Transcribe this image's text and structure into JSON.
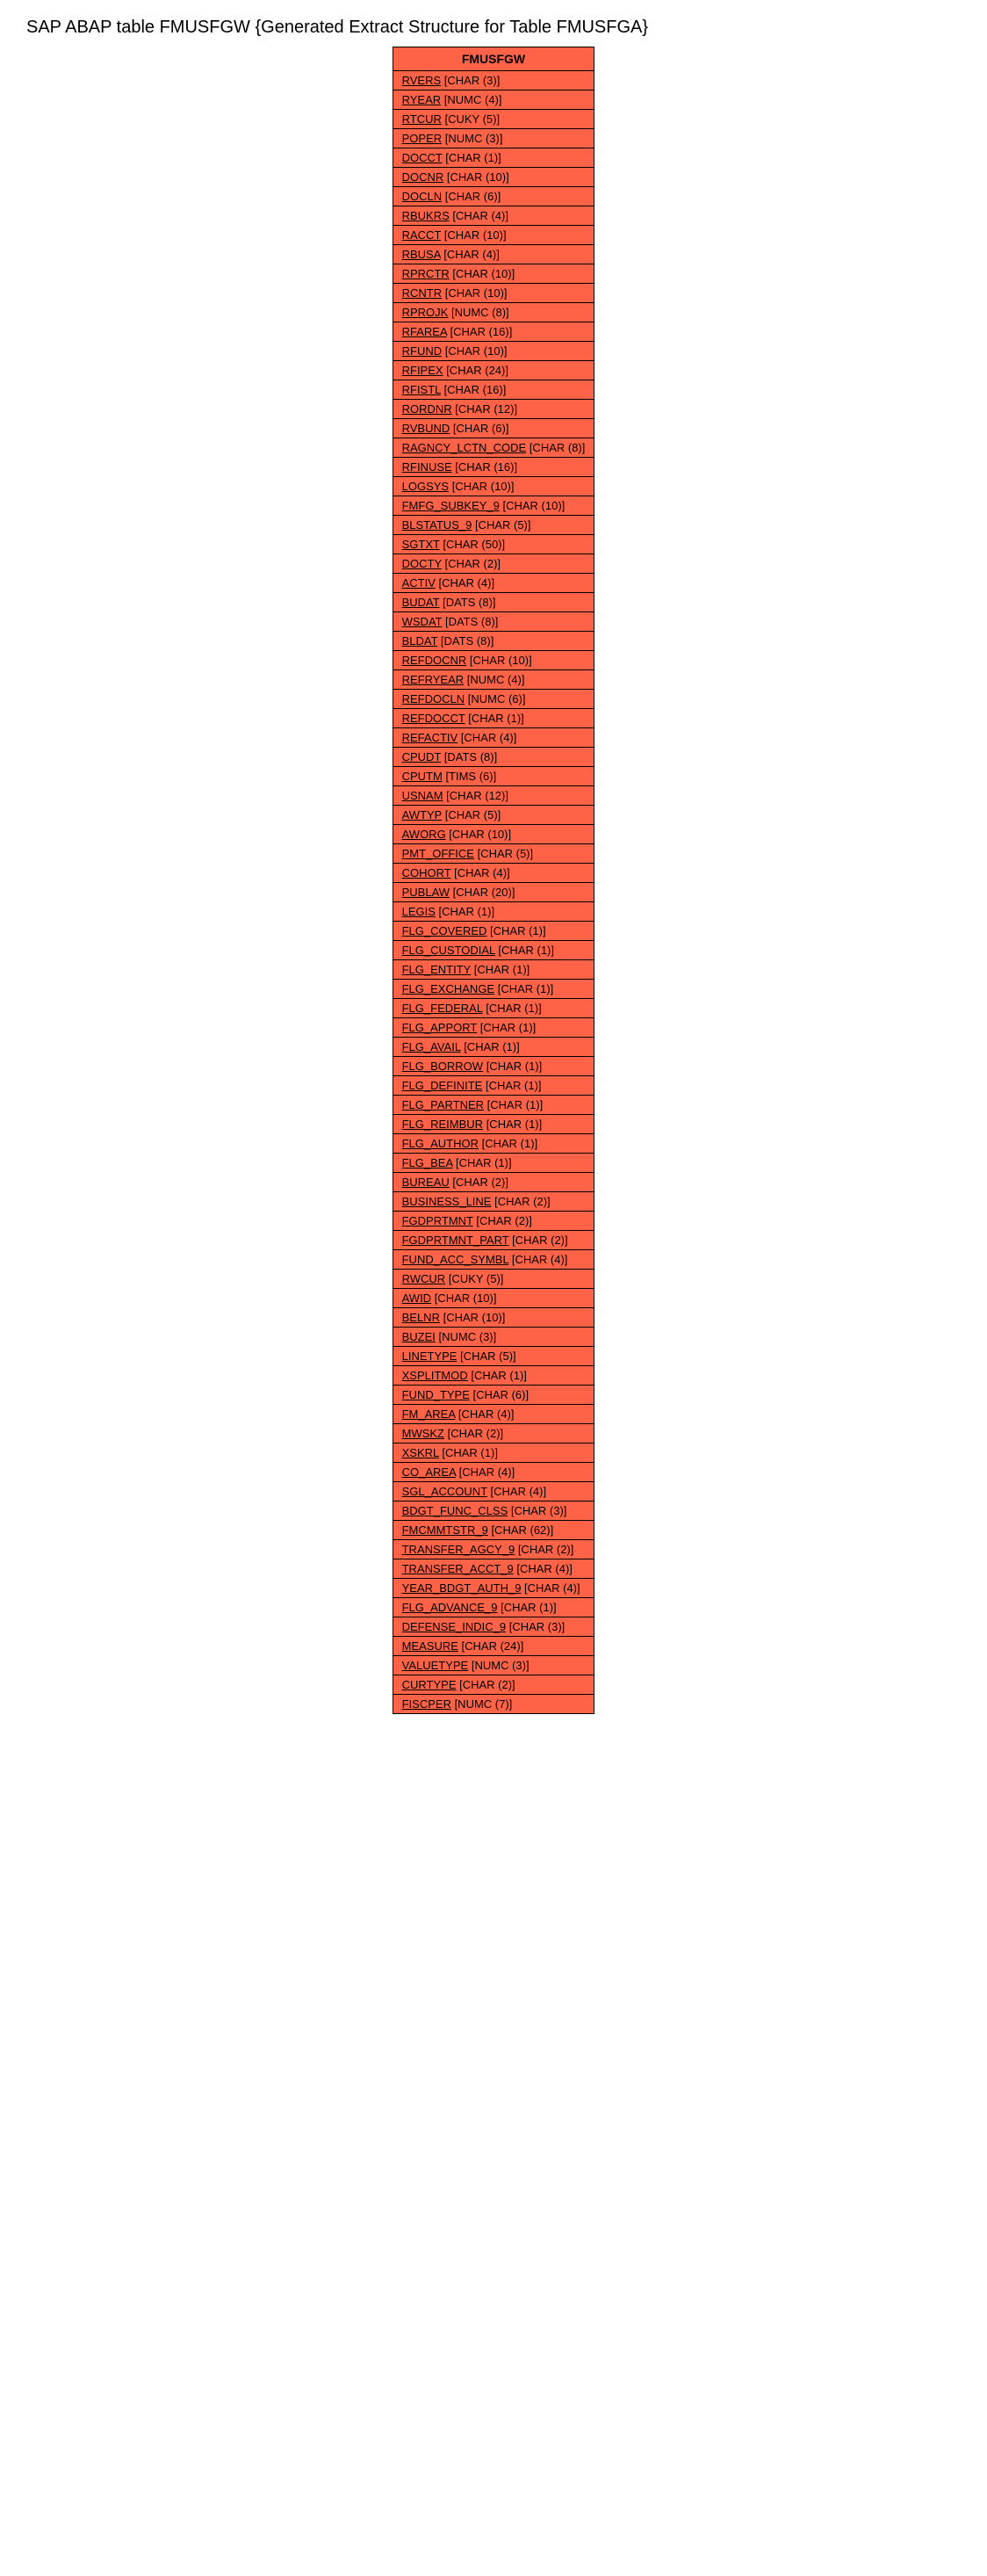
{
  "title": "SAP ABAP table FMUSFGW {Generated Extract Structure for Table FMUSFGA}",
  "table": {
    "header": "FMUSFGW",
    "fields": [
      {
        "name": "RVERS",
        "type": "[CHAR (3)]"
      },
      {
        "name": "RYEAR",
        "type": "[NUMC (4)]"
      },
      {
        "name": "RTCUR",
        "type": "[CUKY (5)]"
      },
      {
        "name": "POPER",
        "type": "[NUMC (3)]"
      },
      {
        "name": "DOCCT",
        "type": "[CHAR (1)]"
      },
      {
        "name": "DOCNR",
        "type": "[CHAR (10)]"
      },
      {
        "name": "DOCLN",
        "type": "[CHAR (6)]"
      },
      {
        "name": "RBUKRS",
        "type": "[CHAR (4)]"
      },
      {
        "name": "RACCT",
        "type": "[CHAR (10)]"
      },
      {
        "name": "RBUSA",
        "type": "[CHAR (4)]"
      },
      {
        "name": "RPRCTR",
        "type": "[CHAR (10)]"
      },
      {
        "name": "RCNTR",
        "type": "[CHAR (10)]"
      },
      {
        "name": "RPROJK",
        "type": "[NUMC (8)]"
      },
      {
        "name": "RFAREA",
        "type": "[CHAR (16)]"
      },
      {
        "name": "RFUND",
        "type": "[CHAR (10)]"
      },
      {
        "name": "RFIPEX",
        "type": "[CHAR (24)]"
      },
      {
        "name": "RFISTL",
        "type": "[CHAR (16)]"
      },
      {
        "name": "RORDNR",
        "type": "[CHAR (12)]"
      },
      {
        "name": "RVBUND",
        "type": "[CHAR (6)]"
      },
      {
        "name": "RAGNCY_LCTN_CODE",
        "type": "[CHAR (8)]"
      },
      {
        "name": "RFINUSE",
        "type": "[CHAR (16)]"
      },
      {
        "name": "LOGSYS",
        "type": "[CHAR (10)]"
      },
      {
        "name": "FMFG_SUBKEY_9",
        "type": "[CHAR (10)]"
      },
      {
        "name": "BLSTATUS_9",
        "type": "[CHAR (5)]"
      },
      {
        "name": "SGTXT",
        "type": "[CHAR (50)]"
      },
      {
        "name": "DOCTY",
        "type": "[CHAR (2)]"
      },
      {
        "name": "ACTIV",
        "type": "[CHAR (4)]"
      },
      {
        "name": "BUDAT",
        "type": "[DATS (8)]"
      },
      {
        "name": "WSDAT",
        "type": "[DATS (8)]"
      },
      {
        "name": "BLDAT",
        "type": "[DATS (8)]"
      },
      {
        "name": "REFDOCNR",
        "type": "[CHAR (10)]"
      },
      {
        "name": "REFRYEAR",
        "type": "[NUMC (4)]"
      },
      {
        "name": "REFDOCLN",
        "type": "[NUMC (6)]"
      },
      {
        "name": "REFDOCCT",
        "type": "[CHAR (1)]"
      },
      {
        "name": "REFACTIV",
        "type": "[CHAR (4)]"
      },
      {
        "name": "CPUDT",
        "type": "[DATS (8)]"
      },
      {
        "name": "CPUTM",
        "type": "[TIMS (6)]"
      },
      {
        "name": "USNAM",
        "type": "[CHAR (12)]"
      },
      {
        "name": "AWTYP",
        "type": "[CHAR (5)]"
      },
      {
        "name": "AWORG",
        "type": "[CHAR (10)]"
      },
      {
        "name": "PMT_OFFICE",
        "type": "[CHAR (5)]"
      },
      {
        "name": "COHORT",
        "type": "[CHAR (4)]"
      },
      {
        "name": "PUBLAW",
        "type": "[CHAR (20)]"
      },
      {
        "name": "LEGIS",
        "type": "[CHAR (1)]"
      },
      {
        "name": "FLG_COVERED",
        "type": "[CHAR (1)]"
      },
      {
        "name": "FLG_CUSTODIAL",
        "type": "[CHAR (1)]"
      },
      {
        "name": "FLG_ENTITY",
        "type": "[CHAR (1)]"
      },
      {
        "name": "FLG_EXCHANGE",
        "type": "[CHAR (1)]"
      },
      {
        "name": "FLG_FEDERAL",
        "type": "[CHAR (1)]"
      },
      {
        "name": "FLG_APPORT",
        "type": "[CHAR (1)]"
      },
      {
        "name": "FLG_AVAIL",
        "type": "[CHAR (1)]"
      },
      {
        "name": "FLG_BORROW",
        "type": "[CHAR (1)]"
      },
      {
        "name": "FLG_DEFINITE",
        "type": "[CHAR (1)]"
      },
      {
        "name": "FLG_PARTNER",
        "type": "[CHAR (1)]"
      },
      {
        "name": "FLG_REIMBUR",
        "type": "[CHAR (1)]"
      },
      {
        "name": "FLG_AUTHOR",
        "type": "[CHAR (1)]"
      },
      {
        "name": "FLG_BEA",
        "type": "[CHAR (1)]"
      },
      {
        "name": "BUREAU",
        "type": "[CHAR (2)]"
      },
      {
        "name": "BUSINESS_LINE",
        "type": "[CHAR (2)]"
      },
      {
        "name": "FGDPRTMNT",
        "type": "[CHAR (2)]"
      },
      {
        "name": "FGDPRTMNT_PART",
        "type": "[CHAR (2)]"
      },
      {
        "name": "FUND_ACC_SYMBL",
        "type": "[CHAR (4)]"
      },
      {
        "name": "RWCUR",
        "type": "[CUKY (5)]"
      },
      {
        "name": "AWID",
        "type": "[CHAR (10)]"
      },
      {
        "name": "BELNR",
        "type": "[CHAR (10)]"
      },
      {
        "name": "BUZEI",
        "type": "[NUMC (3)]"
      },
      {
        "name": "LINETYPE",
        "type": "[CHAR (5)]"
      },
      {
        "name": "XSPLITMOD",
        "type": "[CHAR (1)]"
      },
      {
        "name": "FUND_TYPE",
        "type": "[CHAR (6)]"
      },
      {
        "name": "FM_AREA",
        "type": "[CHAR (4)]"
      },
      {
        "name": "MWSKZ",
        "type": "[CHAR (2)]"
      },
      {
        "name": "XSKRL",
        "type": "[CHAR (1)]"
      },
      {
        "name": "CO_AREA",
        "type": "[CHAR (4)]"
      },
      {
        "name": "SGL_ACCOUNT",
        "type": "[CHAR (4)]"
      },
      {
        "name": "BDGT_FUNC_CLSS",
        "type": "[CHAR (3)]"
      },
      {
        "name": "FMCMMTSTR_9",
        "type": "[CHAR (62)]"
      },
      {
        "name": "TRANSFER_AGCY_9",
        "type": "[CHAR (2)]"
      },
      {
        "name": "TRANSFER_ACCT_9",
        "type": "[CHAR (4)]"
      },
      {
        "name": "YEAR_BDGT_AUTH_9",
        "type": "[CHAR (4)]"
      },
      {
        "name": "FLG_ADVANCE_9",
        "type": "[CHAR (1)]"
      },
      {
        "name": "DEFENSE_INDIC_9",
        "type": "[CHAR (3)]"
      },
      {
        "name": "MEASURE",
        "type": "[CHAR (24)]"
      },
      {
        "name": "VALUETYPE",
        "type": "[NUMC (3)]"
      },
      {
        "name": "CURTYPE",
        "type": "[CHAR (2)]"
      },
      {
        "name": "FISCPER",
        "type": "[NUMC (7)]"
      }
    ]
  }
}
